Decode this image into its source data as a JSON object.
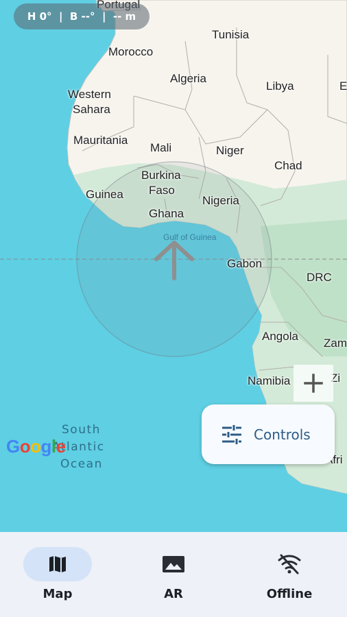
{
  "hud": {
    "text": "H 0°  |  B --°  |  -- m"
  },
  "map": {
    "labels": {
      "portugal": "Portugal",
      "tunisia": "Tunisia",
      "morocco": "Morocco",
      "algeria": "Algeria",
      "libya": "Libya",
      "egypt_partial": "E",
      "western_sahara_1": "Western",
      "western_sahara_2": "Sahara",
      "mauritania": "Mauritania",
      "mali": "Mali",
      "niger": "Niger",
      "chad": "Chad",
      "burkina_1": "Burkina",
      "burkina_2": "Faso",
      "guinea": "Guinea",
      "ghana": "Ghana",
      "nigeria": "Nigeria",
      "gulf_of_guinea": "Gulf of Guinea",
      "gabon": "Gabon",
      "drc": "DRC",
      "angola": "Angola",
      "zambia_partial": "Zam",
      "namibia": "Namibia",
      "zimbabwe_partial": "Zi",
      "south_africa_partial": "Afri"
    },
    "ocean": {
      "line1": "South",
      "line2": "Atlantic",
      "line3": "Ocean"
    },
    "attribution": "Google"
  },
  "zoom_in": {
    "icon": "plus-icon"
  },
  "controls_button": {
    "label": "Controls",
    "icon": "tune-sliders-icon"
  },
  "bottom_nav": {
    "items": [
      {
        "label": "Map",
        "icon": "map-icon",
        "active": true
      },
      {
        "label": "AR",
        "icon": "landscape-icon",
        "active": false
      },
      {
        "label": "Offline",
        "icon": "wifi-off-icon",
        "active": false
      }
    ]
  },
  "colors": {
    "ocean": "#5fcfe3",
    "land": "#f7f4ee",
    "vegetation": "#cfe9d5",
    "accent": "#2d5b86",
    "nav_active": "#d4e3f8"
  }
}
